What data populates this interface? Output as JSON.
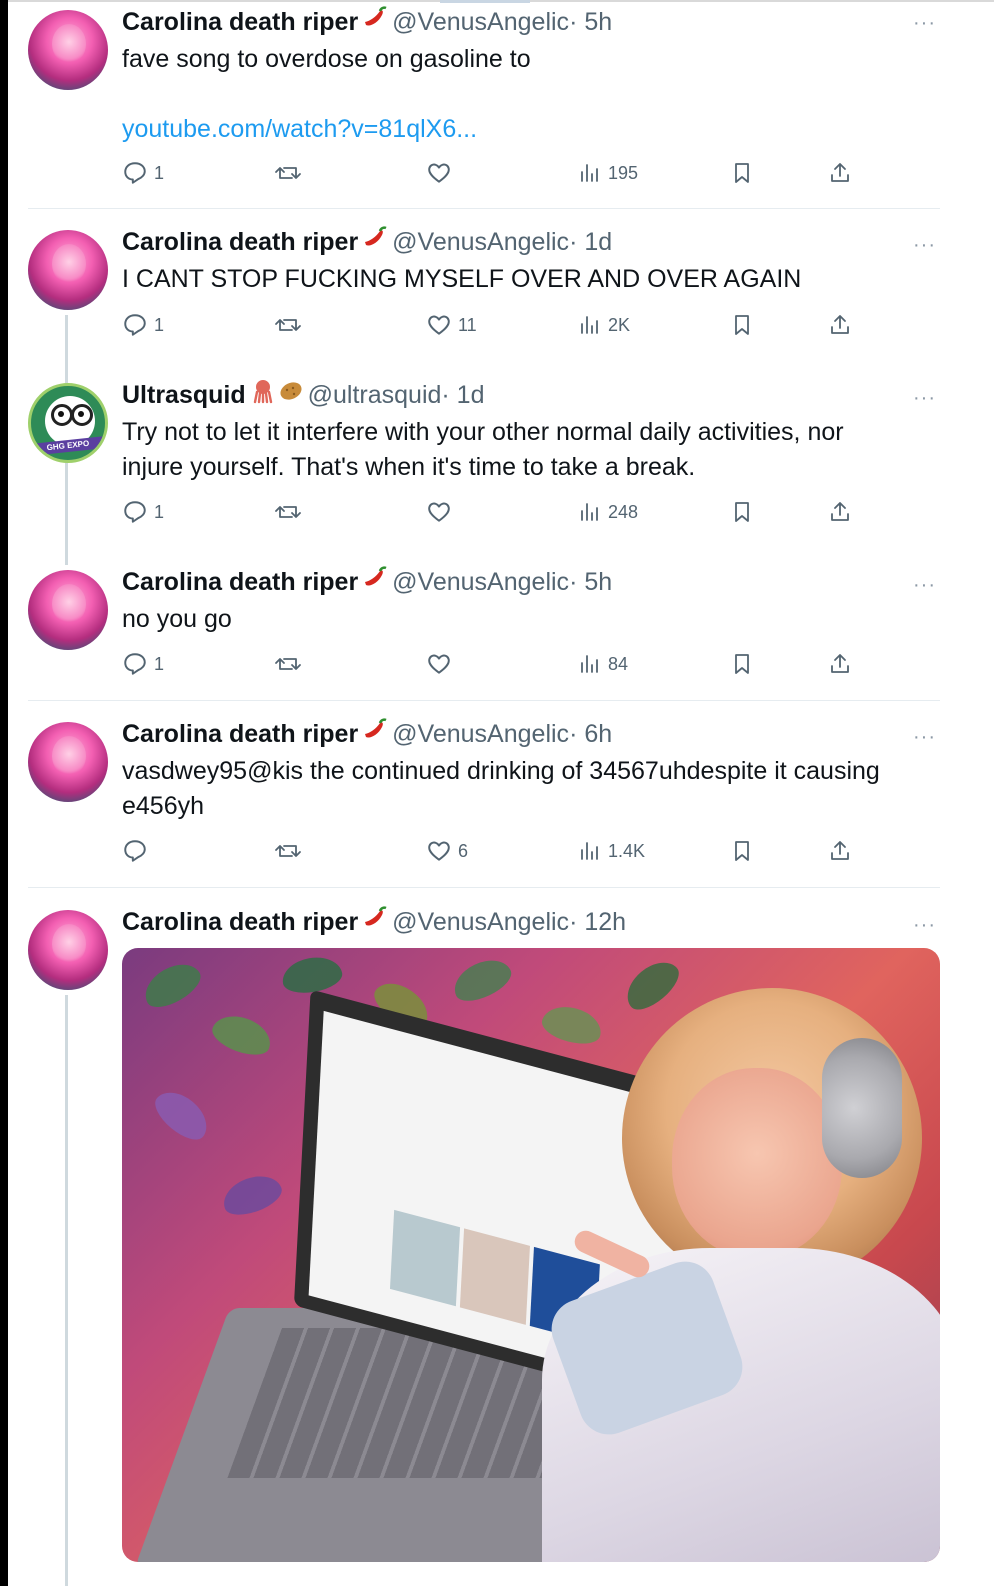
{
  "tweets": [
    {
      "name": "Carolina death riper",
      "name_emoji": "hot-pepper",
      "handle": "@VenusAngelic",
      "time": "· 5h",
      "text": "fave song to overdose on gasoline to",
      "link": "youtube.com/watch?v=81qlX6...",
      "stats": {
        "replies": "1",
        "reposts": "",
        "likes": "",
        "views": "195"
      }
    },
    {
      "name": "Carolina death riper",
      "name_emoji": "hot-pepper",
      "handle": "@VenusAngelic",
      "time": "· 1d",
      "text": "I CANT STOP FUCKING MYSELF OVER AND OVER AGAIN",
      "stats": {
        "replies": "1",
        "reposts": "",
        "likes": "11",
        "views": "2K"
      }
    },
    {
      "name": "Ultrasquid",
      "name_emoji": "squid, potato",
      "avatar_text": "GHG EXPO",
      "handle": "@ultrasquid",
      "time": "· 1d",
      "text_line1": "Try not to let it interfere with your other normal daily activities, nor",
      "text_line2": "injure yourself. That's when it's time to take a break.",
      "stats": {
        "replies": "1",
        "reposts": "",
        "likes": "",
        "views": "248"
      }
    },
    {
      "name": "Carolina death riper",
      "name_emoji": "hot-pepper",
      "handle": "@VenusAngelic",
      "time": "· 5h",
      "text": "no you go",
      "stats": {
        "replies": "1",
        "reposts": "",
        "likes": "",
        "views": "84"
      }
    },
    {
      "name": "Carolina death riper",
      "name_emoji": "hot-pepper",
      "handle": "@VenusAngelic",
      "time": "· 6h",
      "text_line1": "vasdwey95@kis the continued drinking of 34567uhdespite it causing",
      "text_line2": "e456yh",
      "stats": {
        "replies": "",
        "reposts": "",
        "likes": "6",
        "views": "1.4K"
      }
    },
    {
      "name": "Carolina death riper",
      "name_emoji": "hot-pepper",
      "handle": "@VenusAngelic",
      "time": "· 12h",
      "media": "photo-selfie-with-laptop"
    }
  ],
  "more_icon": "more-dots-icon",
  "colors": {
    "link": "#1d9bf0",
    "secondary_text": "#536471",
    "separator": "#e6ecf0",
    "thread_line": "#cfd9de"
  }
}
